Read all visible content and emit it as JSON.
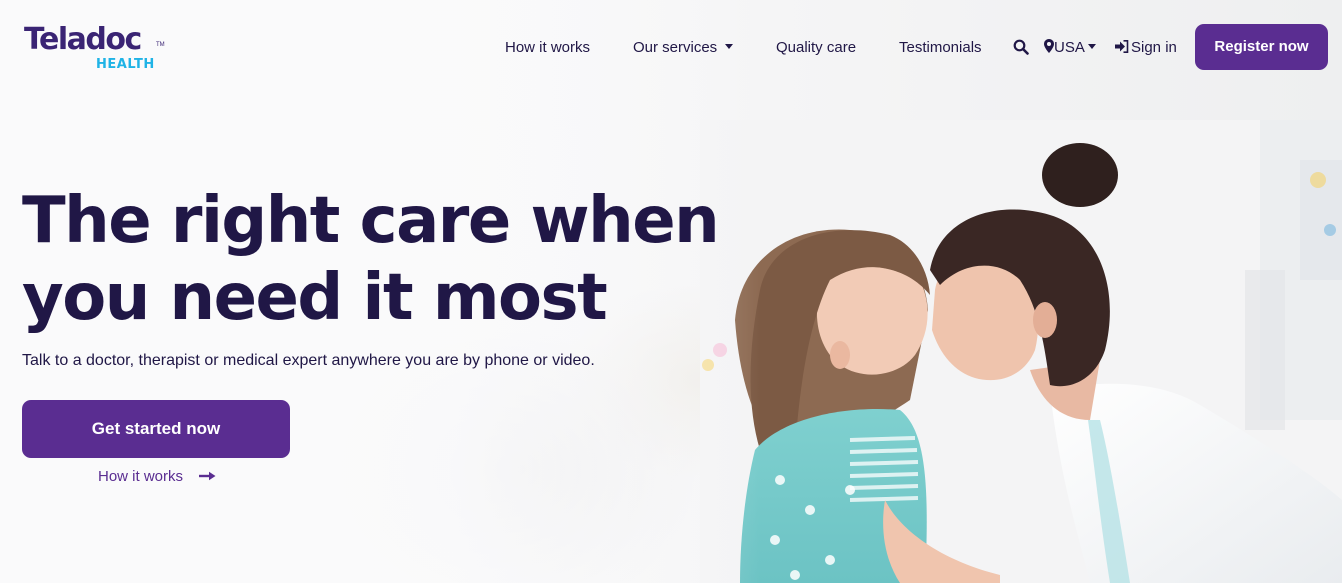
{
  "brand": {
    "name": "Teladoc",
    "sub": "HEALTH",
    "tm": "TM",
    "primary_color": "#5a2d91",
    "text_color": "#201746",
    "accent_color": "#1fb3e6"
  },
  "nav": {
    "items": [
      {
        "label": "How it works",
        "has_dropdown": false
      },
      {
        "label": "Our services",
        "has_dropdown": true
      },
      {
        "label": "Quality care",
        "has_dropdown": false
      },
      {
        "label": "Testimonials",
        "has_dropdown": false
      }
    ],
    "search_icon": "search-icon",
    "region": {
      "icon": "map-marker-icon",
      "label": "USA",
      "has_dropdown": true
    },
    "sign_in": {
      "icon": "sign-in-icon",
      "label": "Sign in"
    },
    "register_label": "Register now"
  },
  "hero": {
    "title_line1": "The right care when",
    "title_line2": "you need it most",
    "subtitle": "Talk to a doctor, therapist or medical expert anywhere you are by phone or video.",
    "cta_label": "Get started now",
    "secondary_link": {
      "label": "How it works",
      "icon": "arrow-right-icon"
    },
    "image_alt": "Mother and daughter touching foreheads"
  }
}
